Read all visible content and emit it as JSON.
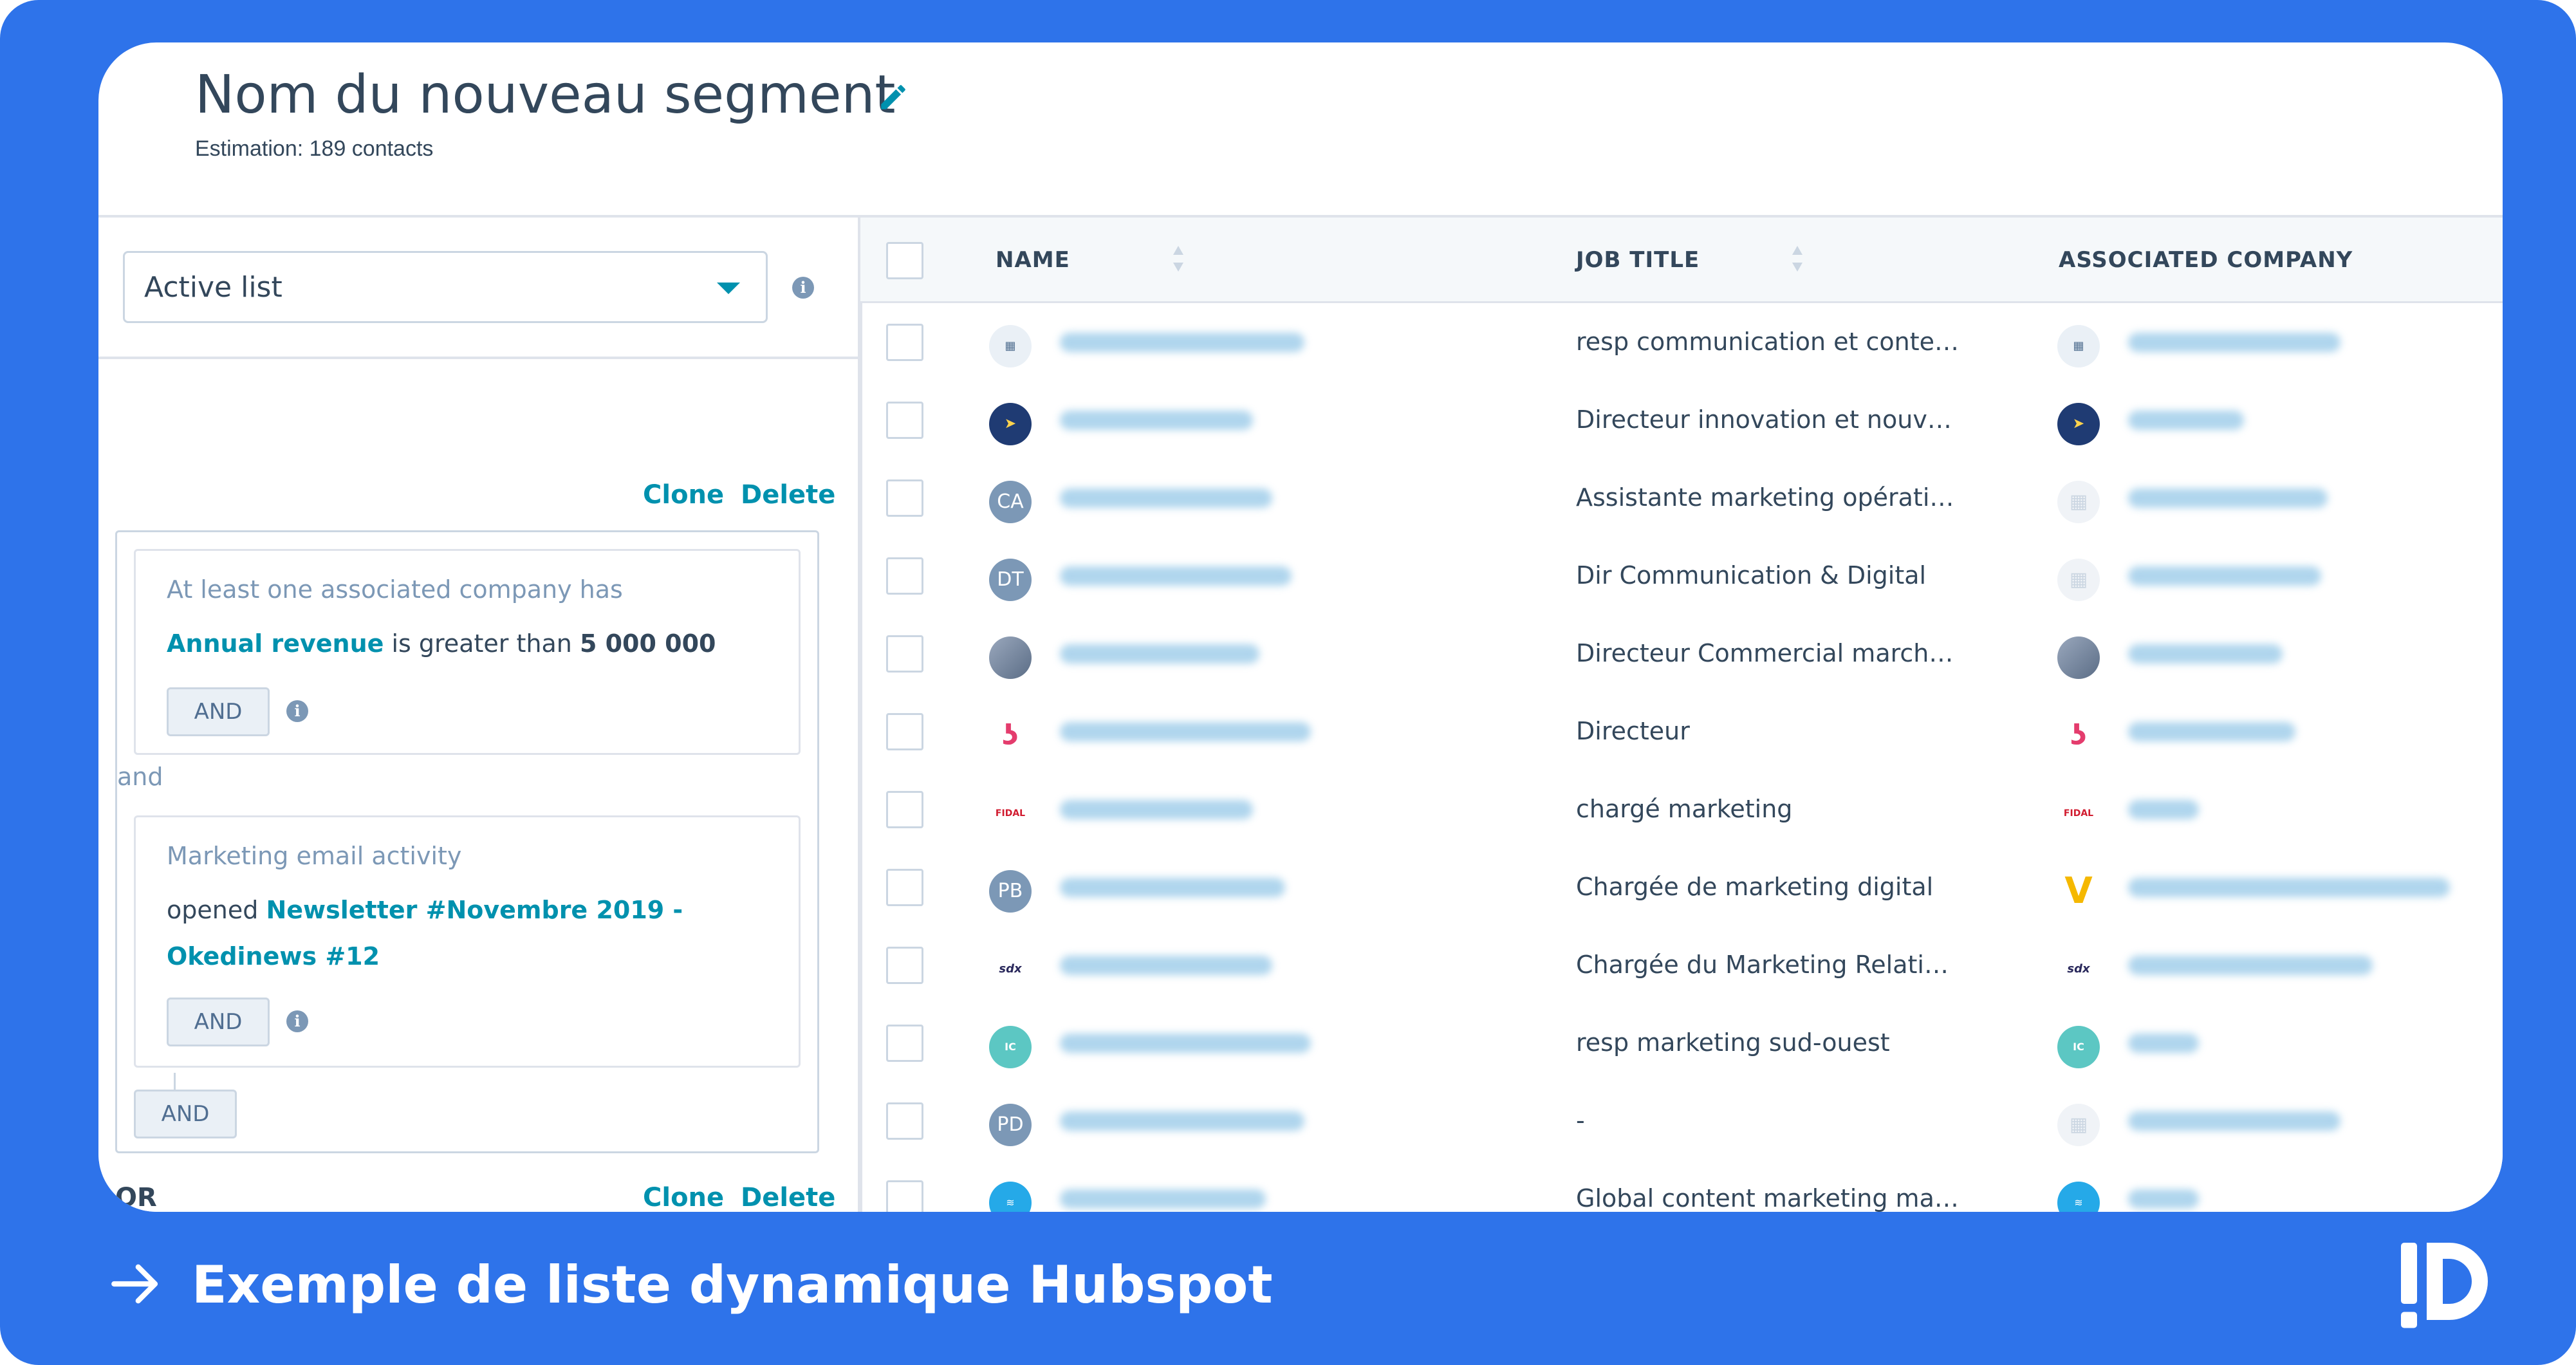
{
  "header": {
    "title": "Nom du nouveau segment",
    "estimate": "Estimation: 189 contacts"
  },
  "filters": {
    "list_type": "Active list",
    "clone_label": "Clone",
    "delete_label": "Delete",
    "card1": {
      "heading": "At least one associated company has",
      "property": "Annual revenue",
      "operator": "is greater than",
      "value": "5 000 000",
      "and_button": "AND"
    },
    "connector": "and",
    "card2": {
      "heading": "Marketing email activity",
      "verb": "opened",
      "email_line1": "Newsletter #Novembre 2019 -",
      "email_line2": "Okedinews #12",
      "and_button": "AND"
    },
    "group_and_button": "AND",
    "or_label": "OR"
  },
  "table": {
    "columns": {
      "name": "NAME",
      "job_title": "JOB TITLE",
      "company": "ASSOCIATED COMPANY"
    },
    "rows": [
      {
        "avatar": "",
        "job": "resp communication et conte…"
      },
      {
        "avatar": "",
        "job": "Directeur innovation et nouv…"
      },
      {
        "avatar": "CA",
        "job": "Assistante marketing opérati…"
      },
      {
        "avatar": "DT",
        "job": "Dir Communication & Digital"
      },
      {
        "avatar": "",
        "job": "Directeur Commercial march…"
      },
      {
        "avatar": "",
        "job": "Directeur"
      },
      {
        "avatar": "",
        "job": "chargé marketing"
      },
      {
        "avatar": "PB",
        "job": "Chargée de marketing digital"
      },
      {
        "avatar": "",
        "job": "Chargée du Marketing Relati…"
      },
      {
        "avatar": "",
        "job": "resp marketing sud-ouest"
      },
      {
        "avatar": "PD",
        "job": "-"
      },
      {
        "avatar": "",
        "job": "Global content marketing ma…"
      }
    ]
  },
  "footer": {
    "caption": "Exemple de liste dynamique Hubspot"
  },
  "colors": {
    "brand_blue": "#2e73ea",
    "link_teal": "#0091ae",
    "text_dark": "#33475b"
  }
}
